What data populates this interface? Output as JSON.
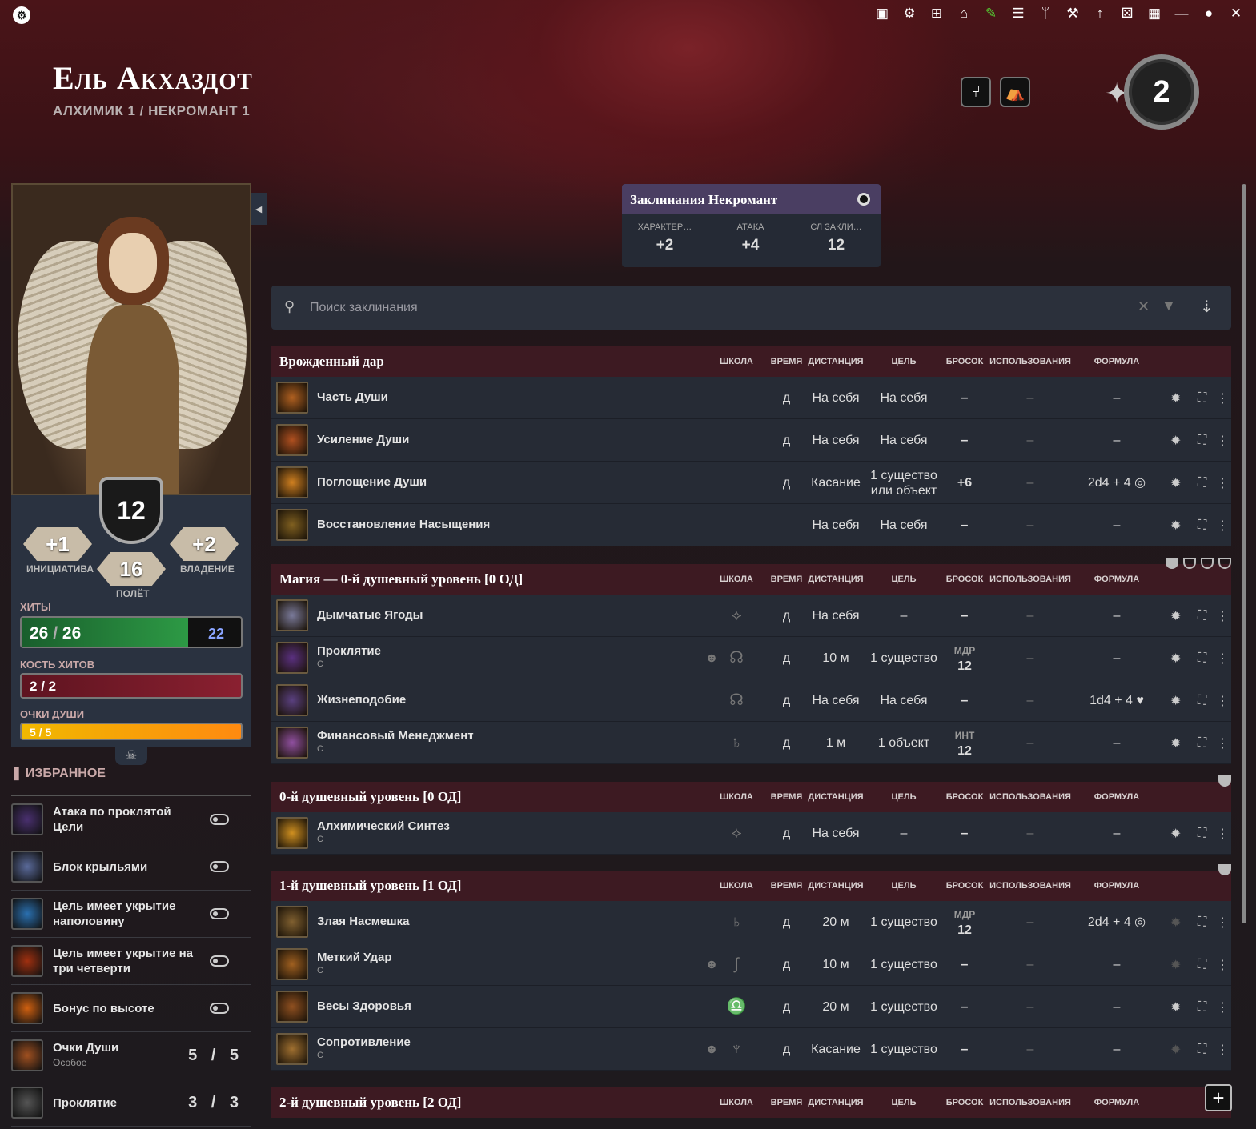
{
  "character": {
    "name": "Ель Акхаздот",
    "classes": "АЛХИМИК 1 / НЕКРОМАНТ 1",
    "level": "2"
  },
  "stats": {
    "ac": "12",
    "initiative": "+1",
    "initiative_label": "ИНИЦИАТИВА",
    "proficiency": "+2",
    "proficiency_label": "ВЛАДЕНИЕ",
    "speed": "16",
    "speed_label": "ПОЛЁТ",
    "hp_label": "ХИТЫ",
    "hp_value": "26",
    "hp_max": "26",
    "hp_temp": "22",
    "hp_fraction": 1.0,
    "hd_label": "КОСТЬ ХИТОВ",
    "hd_value": "2",
    "hd_max": "2",
    "soul_label": "ОЧКИ ДУШИ",
    "soul_value": "5",
    "soul_max": "5"
  },
  "spellcard": {
    "title": "Заклинания Некромант",
    "stat1_label": "ХАРАКТЕР…",
    "stat1_value": "+2",
    "stat2_label": "АТАКА",
    "stat2_value": "+4",
    "stat3_label": "СЛ ЗАКЛИ…",
    "stat3_value": "12"
  },
  "search": {
    "placeholder": "Поиск заклинания"
  },
  "columns": {
    "school": "ШКОЛА",
    "time": "ВРЕМЯ",
    "range": "ДИСТАНЦИЯ",
    "target": "ЦЕЛЬ",
    "roll": "БРОСОК",
    "uses": "ИСПОЛЬЗОВАНИЯ",
    "formula": "ФОРМУЛА"
  },
  "favorites": {
    "title": "ИЗБРАННОЕ",
    "items": [
      {
        "label": "Атака по проклятой Цели",
        "type": "toggle",
        "color": "#4a3070"
      },
      {
        "label": "Блок крыльями",
        "type": "toggle",
        "color": "#5a6a9a"
      },
      {
        "label": "Цель имеет укрытие наполовину",
        "type": "toggle",
        "color": "#2a70b0"
      },
      {
        "label": "Цель имеет укрытие на три четверти",
        "type": "toggle",
        "color": "#a03010"
      },
      {
        "label": "Бонус по высоте",
        "type": "toggle",
        "color": "#d06010"
      },
      {
        "label": "Очки Души",
        "sub": "Особое",
        "type": "count",
        "value": "5",
        "max": "5",
        "color": "#a05020"
      },
      {
        "label": "Проклятие",
        "type": "count",
        "value": "3",
        "max": "3",
        "color": "#555"
      }
    ]
  },
  "sections": [
    {
      "title": "Врожденный дар",
      "pips": "",
      "spells": [
        {
          "name": "Часть Души",
          "sub": "",
          "conc": "",
          "school": "",
          "time": "д",
          "range": "На себя",
          "target": "На себя",
          "roll": "–",
          "rolllabel": "",
          "uses": "–",
          "formula": "–",
          "color": "#b06020"
        },
        {
          "name": "Усиление Души",
          "sub": "",
          "conc": "",
          "school": "",
          "time": "д",
          "range": "На себя",
          "target": "На себя",
          "roll": "–",
          "rolllabel": "",
          "uses": "–",
          "formula": "–",
          "color": "#b05020"
        },
        {
          "name": "Поглощение Души",
          "sub": "",
          "conc": "",
          "school": "",
          "time": "д",
          "range": "Касание",
          "target": "1 существо или объект",
          "roll": "+6",
          "rolllabel": "",
          "uses": "–",
          "formula": "2d4 + 4 ◎",
          "color": "#d08020"
        },
        {
          "name": "Восстановление Насыщения",
          "sub": "",
          "conc": "",
          "school": "",
          "time": "",
          "range": "На себя",
          "target": "На себя",
          "roll": "–",
          "rolllabel": "",
          "uses": "–",
          "formula": "–",
          "color": "#806020"
        }
      ]
    },
    {
      "title": "Магия — 0-й душевный уровень [0 ОД]",
      "pips": "4",
      "spells": [
        {
          "name": "Дымчатые Ягоды",
          "sub": "",
          "conc": "",
          "school": "⟡",
          "time": "д",
          "range": "На себя",
          "target": "–",
          "roll": "–",
          "rolllabel": "",
          "uses": "–",
          "formula": "–",
          "color": "#7a7a9a"
        },
        {
          "name": "Проклятие",
          "sub": "С",
          "conc": "☻",
          "school": "☊",
          "time": "д",
          "range": "10 м",
          "target": "1 существо",
          "roll": "12",
          "rolllabel": "МДР",
          "uses": "–",
          "formula": "–",
          "color": "#5a3080"
        },
        {
          "name": "Жизнеподобие",
          "sub": "",
          "conc": "",
          "school": "☊",
          "time": "д",
          "range": "На себя",
          "target": "На себя",
          "roll": "–",
          "rolllabel": "",
          "uses": "–",
          "formula": "1d4 + 4 ♥",
          "color": "#5a4080"
        },
        {
          "name": "Финансовый Менеджмент",
          "sub": "С",
          "conc": "",
          "school": "♄",
          "time": "д",
          "range": "1 м",
          "target": "1 объект",
          "roll": "12",
          "rolllabel": "ИНТ",
          "uses": "–",
          "formula": "–",
          "color": "#9050a0"
        }
      ]
    },
    {
      "title": "0-й душевный уровень [0 ОД]",
      "pips": "1",
      "spells": [
        {
          "name": "Алхимический Синтез",
          "sub": "С",
          "conc": "",
          "school": "⟡",
          "time": "д",
          "range": "На себя",
          "target": "–",
          "roll": "–",
          "rolllabel": "",
          "uses": "–",
          "formula": "–",
          "color": "#d09020"
        }
      ]
    },
    {
      "title": "1-й душевный уровень [1 ОД]",
      "pips": "1",
      "spells": [
        {
          "name": "Злая Насмешка",
          "sub": "",
          "conc": "",
          "school": "♄",
          "time": "д",
          "range": "20 м",
          "target": "1 существо",
          "roll": "12",
          "rolllabel": "МДР",
          "uses": "–",
          "formula": "2d4 + 4 ◎",
          "color": "#806030"
        },
        {
          "name": "Меткий Удар",
          "sub": "С",
          "conc": "☻",
          "school": "∫",
          "time": "д",
          "range": "10 м",
          "target": "1 существо",
          "roll": "–",
          "rolllabel": "",
          "uses": "–",
          "formula": "–",
          "color": "#a06020"
        },
        {
          "name": "Весы Здоровья",
          "sub": "",
          "conc": "",
          "school": "♎",
          "time": "д",
          "range": "20 м",
          "target": "1 существо",
          "roll": "–",
          "rolllabel": "",
          "uses": "–",
          "formula": "–",
          "color": "#905020"
        },
        {
          "name": "Сопротивление",
          "sub": "С",
          "conc": "☻",
          "school": "♆",
          "time": "д",
          "range": "Касание",
          "target": "1 существо",
          "roll": "–",
          "rolllabel": "",
          "uses": "–",
          "formula": "–",
          "color": "#a07030"
        }
      ]
    },
    {
      "title": "2-й душевный уровень [2 ОД]",
      "pips": "",
      "spells": []
    }
  ]
}
